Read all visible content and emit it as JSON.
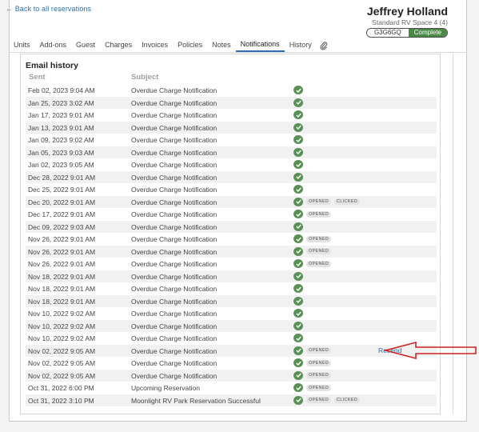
{
  "header": {
    "back_link": "← Back to all reservations",
    "guest_name": "Jeffrey Holland",
    "space": "Standard RV Space 4 (4)",
    "confirmation_code": "G3G6GQ",
    "status": "Complete",
    "status_color": "#4a8a45",
    "accent_color": "#2b6fb0"
  },
  "tabs": [
    {
      "label": "Units"
    },
    {
      "label": "Add-ons"
    },
    {
      "label": "Guest"
    },
    {
      "label": "Charges"
    },
    {
      "label": "Invoices"
    },
    {
      "label": "Policies"
    },
    {
      "label": "Notes"
    },
    {
      "label": "Notifications",
      "active": true
    },
    {
      "label": "History"
    }
  ],
  "tab_attachment_icon": "paperclip-icon",
  "email_history": {
    "title": "Email history",
    "col_sent": "Sent",
    "col_subject": "Subject",
    "check_icon": "check-circle-icon",
    "check_color": "#5a8f57",
    "rows": [
      {
        "sent": "Feb 02, 2023 9:04 AM",
        "subject": "Overdue Charge Notification",
        "badges": []
      },
      {
        "sent": "Jan 25, 2023 3:02 AM",
        "subject": "Overdue Charge Notification",
        "badges": []
      },
      {
        "sent": "Jan 17, 2023 9:01 AM",
        "subject": "Overdue Charge Notification",
        "badges": []
      },
      {
        "sent": "Jan 13, 2023 9:01 AM",
        "subject": "Overdue Charge Notification",
        "badges": []
      },
      {
        "sent": "Jan 09, 2023 9:02 AM",
        "subject": "Overdue Charge Notification",
        "badges": []
      },
      {
        "sent": "Jan 05, 2023 9:03 AM",
        "subject": "Overdue Charge Notification",
        "badges": []
      },
      {
        "sent": "Jan 02, 2023 9:05 AM",
        "subject": "Overdue Charge Notification",
        "badges": []
      },
      {
        "sent": "Dec 28, 2022 9:01 AM",
        "subject": "Overdue Charge Notification",
        "badges": []
      },
      {
        "sent": "Dec 25, 2022 9:01 AM",
        "subject": "Overdue Charge Notification",
        "badges": []
      },
      {
        "sent": "Dec 20, 2022 9:01 AM",
        "subject": "Overdue Charge Notification",
        "badges": [
          "OPENED",
          "CLICKED"
        ]
      },
      {
        "sent": "Dec 17, 2022 9:01 AM",
        "subject": "Overdue Charge Notification",
        "badges": [
          "OPENED"
        ]
      },
      {
        "sent": "Dec 09, 2022 9:03 AM",
        "subject": "Overdue Charge Notification",
        "badges": []
      },
      {
        "sent": "Nov 26, 2022 9:01 AM",
        "subject": "Overdue Charge Notification",
        "badges": [
          "OPENED"
        ]
      },
      {
        "sent": "Nov 26, 2022 9:01 AM",
        "subject": "Overdue Charge Notification",
        "badges": [
          "OPENED"
        ]
      },
      {
        "sent": "Nov 26, 2022 9:01 AM",
        "subject": "Overdue Charge Notification",
        "badges": [
          "OPENED"
        ]
      },
      {
        "sent": "Nov 18, 2022 9:01 AM",
        "subject": "Overdue Charge Notification",
        "badges": []
      },
      {
        "sent": "Nov 18, 2022 9:01 AM",
        "subject": "Overdue Charge Notification",
        "badges": []
      },
      {
        "sent": "Nov 18, 2022 9:01 AM",
        "subject": "Overdue Charge Notification",
        "badges": []
      },
      {
        "sent": "Nov 10, 2022 9:02 AM",
        "subject": "Overdue Charge Notification",
        "badges": []
      },
      {
        "sent": "Nov 10, 2022 9:02 AM",
        "subject": "Overdue Charge Notification",
        "badges": []
      },
      {
        "sent": "Nov 10, 2022 9:02 AM",
        "subject": "Overdue Charge Notification",
        "badges": []
      },
      {
        "sent": "Nov 02, 2022 9:05 AM",
        "subject": "Overdue Charge Notification",
        "badges": [
          "OPENED"
        ],
        "action": "Resend"
      },
      {
        "sent": "Nov 02, 2022 9:05 AM",
        "subject": "Overdue Charge Notification",
        "badges": [
          "OPENED"
        ]
      },
      {
        "sent": "Nov 02, 2022 9:05 AM",
        "subject": "Overdue Charge Notification",
        "badges": [
          "OPENED"
        ]
      },
      {
        "sent": "Oct 31, 2022 6:00 PM",
        "subject": "Upcoming Reservation",
        "badges": [
          "OPENED"
        ]
      },
      {
        "sent": "Oct 31, 2022 3:10 PM",
        "subject": "Moonlight RV Park Reservation Successful",
        "badges": [
          "OPENED",
          "CLICKED"
        ]
      }
    ]
  },
  "annotation": {
    "arrow_color": "#cc2222",
    "arrow_icon": "left-arrow-icon"
  }
}
